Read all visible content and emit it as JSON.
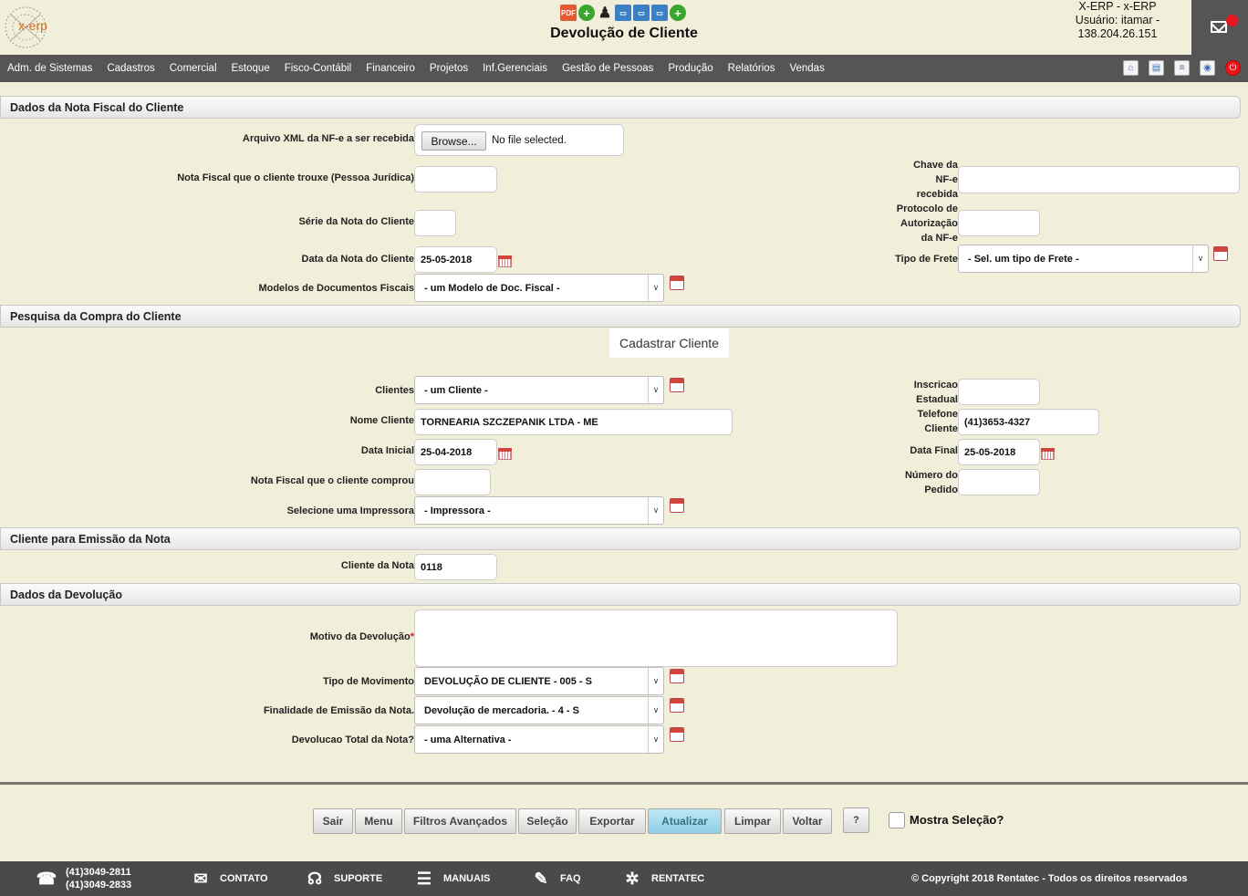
{
  "header": {
    "logo_text": "x-erp",
    "title": "Devolução de Cliente",
    "user_line1": "X-ERP - x-ERP",
    "user_line2": "Usuário: itamar -",
    "user_line3": "138.204.26.151"
  },
  "nav": {
    "items": [
      "Adm. de Sistemas",
      "Cadastros",
      "Comercial",
      "Estoque",
      "Fisco-Contábil",
      "Financeiro",
      "Projetos",
      "Inf.Gerenciais",
      "Gestão de Pessoas",
      "Produção",
      "Relatórios",
      "Vendas"
    ]
  },
  "sections": {
    "nota_fiscal": "Dados da Nota Fiscal do Cliente",
    "pesquisa": "Pesquisa da Compra do Cliente",
    "emissao": "Cliente para Emissão da Nota",
    "devolucao": "Dados da Devolução"
  },
  "nf": {
    "xml_label": "Arquivo XML da NF-e a ser recebida",
    "browse_label": "Browse...",
    "file_status": "No file selected.",
    "nota_label": "Nota Fiscal que o cliente trouxe (Pessoa Jurídica)",
    "nota_value": "",
    "chave_label_1": "Chave da",
    "chave_label_2": "NF-e",
    "chave_label_3": "recebida",
    "chave_value": "",
    "serie_label": "Série da Nota do Cliente",
    "serie_value": "",
    "protocolo_label_1": "Protocolo de",
    "protocolo_label_2": "Autorização",
    "protocolo_label_3": "da NF-e",
    "protocolo_value": "",
    "data_label": "Data da Nota do Cliente",
    "data_value": "25-05-2018",
    "frete_label": "Tipo de Frete",
    "frete_value": "- Sel. um tipo de Frete -",
    "modelos_label": "Modelos de Documentos Fiscais",
    "modelos_value": "- um Modelo de Doc. Fiscal -"
  },
  "pesquisa": {
    "cadastrar_label": "Cadastrar Cliente",
    "clientes_label": "Clientes",
    "clientes_value": "- um Cliente -",
    "inscricao_label_1": "Inscricao",
    "inscricao_label_2": "Estadual",
    "inscricao_value": "",
    "nome_label": "Nome Cliente",
    "nome_value": "TORNEARIA SZCZEPANIK LTDA - ME",
    "telefone_label_1": "Telefone",
    "telefone_label_2": "Cliente",
    "telefone_value": "(41)3653-4327",
    "data_inicial_label": "Data Inicial",
    "data_inicial_value": "25-04-2018",
    "data_final_label": "Data Final",
    "data_final_value": "25-05-2018",
    "nf_comprou_label": "Nota Fiscal que o cliente comprou",
    "nf_comprou_value": "",
    "pedido_label_1": "Número do",
    "pedido_label_2": "Pedido",
    "pedido_value": "",
    "impressora_label": "Selecione uma Impressora",
    "impressora_value": "- Impressora -"
  },
  "emissao": {
    "cliente_label": "Cliente da Nota",
    "cliente_value": "0118"
  },
  "devolucao": {
    "motivo_label": "Motivo da Devolução",
    "required_mark": "*",
    "motivo_value": "",
    "tipo_label": "Tipo de Movimento",
    "tipo_value": "DEVOLUÇÃO DE CLIENTE - 005 - S",
    "finalidade_label": "Finalidade de Emissão da Nota.",
    "finalidade_value": "Devolução de mercadoria. - 4 - S",
    "total_label": "Devolucao Total da Nota?",
    "total_value": "- uma Alternativa -"
  },
  "buttons": {
    "sair": "Sair",
    "menu": "Menu",
    "filtros": "Filtros Avançados",
    "selecao": "Seleção",
    "exportar": "Exportar",
    "atualizar": "Atualizar",
    "limpar": "Limpar",
    "voltar": "Voltar",
    "help": "?",
    "mostra_selecao": "Mostra Seleção?"
  },
  "footer": {
    "phone1": "(41)3049-2811",
    "phone2": "(41)3049-2833",
    "contato": "CONTATO",
    "suporte": "SUPORTE",
    "manuais": "MANUAIS",
    "faq": "FAQ",
    "rentatec": "RENTATEC",
    "copyright": "© Copyright 2018 Rentatec - Todos os direitos reservados"
  }
}
